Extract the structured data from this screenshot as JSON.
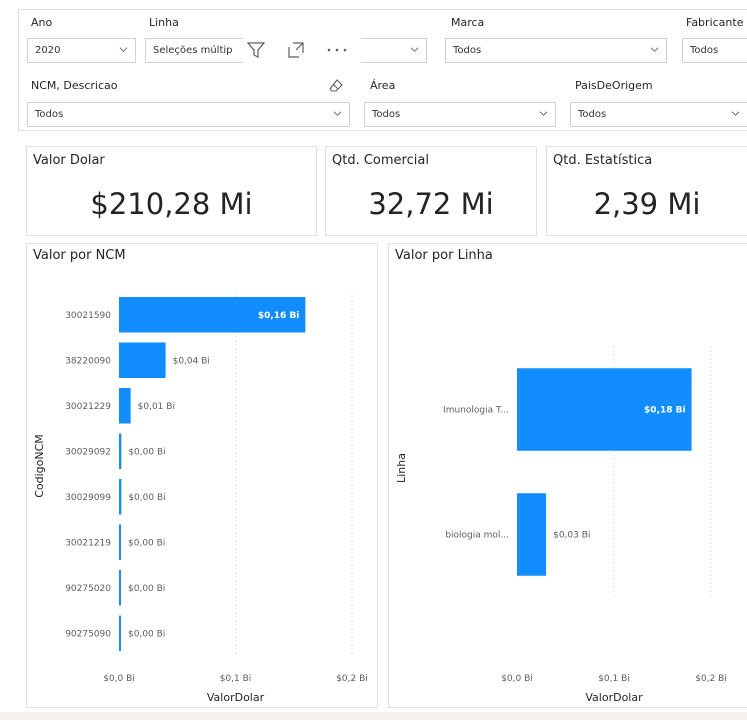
{
  "slicers": {
    "ano": {
      "label": "Ano",
      "value": "2020"
    },
    "linha": {
      "label": "Linha",
      "value": "Seleções múltip"
    },
    "marca": {
      "label": "Marca",
      "value": "Todos"
    },
    "fabricante": {
      "label": "Fabricante",
      "value": "Todos"
    },
    "ncm": {
      "label": "NCM, Descricao",
      "value": "Todos"
    },
    "area": {
      "label": "Área",
      "value": "Todos"
    },
    "pais": {
      "label": "PaisDeOrigem",
      "value": "Todos"
    }
  },
  "toolbar_icons": [
    "filter-icon",
    "focus-mode-icon",
    "more-options-icon",
    "eraser-icon"
  ],
  "cards": [
    {
      "title": "Valor Dolar",
      "value": "$210,28 Mi"
    },
    {
      "title": "Qtd. Comercial",
      "value": "32,72 Mi"
    },
    {
      "title": "Qtd. Estatística",
      "value": "2,39 Mi"
    }
  ],
  "colors": {
    "bar": "#118DFF",
    "border": "#E1DFDD",
    "grid": "#D0D0D0"
  },
  "chart_data": [
    {
      "type": "bar",
      "orientation": "horizontal",
      "title": "Valor por NCM",
      "xlabel": "ValorDolar",
      "ylabel": "CodigoNCM",
      "categories": [
        "30021590",
        "38220090",
        "30021229",
        "30029092",
        "30029099",
        "30021219",
        "90275020",
        "90275090"
      ],
      "values": [
        0.16,
        0.04,
        0.01,
        0.002,
        0.002,
        0.001,
        0.001,
        0.001
      ],
      "data_labels": [
        "$0,16 Bi",
        "$0,04 Bi",
        "$0,01 Bi",
        "$0,00 Bi",
        "$0,00 Bi",
        "$0,00 Bi",
        "$0,00 Bi",
        "$0,00 Bi"
      ],
      "xlim": [
        0,
        0.2
      ],
      "ticks": [
        "$0,0 Bi",
        "$0,1 Bi",
        "$0,2 Bi"
      ],
      "grid": true
    },
    {
      "type": "bar",
      "orientation": "horizontal",
      "title": "Valor por Linha",
      "xlabel": "ValorDolar",
      "ylabel": "Linha",
      "categories": [
        "Imunologia T...",
        "biologia mol..."
      ],
      "values": [
        0.18,
        0.03
      ],
      "data_labels": [
        "$0,18 Bi",
        "$0,03 Bi"
      ],
      "xlim": [
        0,
        0.2
      ],
      "ticks": [
        "$0,0 Bi",
        "$0,1 Bi",
        "$0,2 Bi"
      ],
      "grid": true
    }
  ]
}
